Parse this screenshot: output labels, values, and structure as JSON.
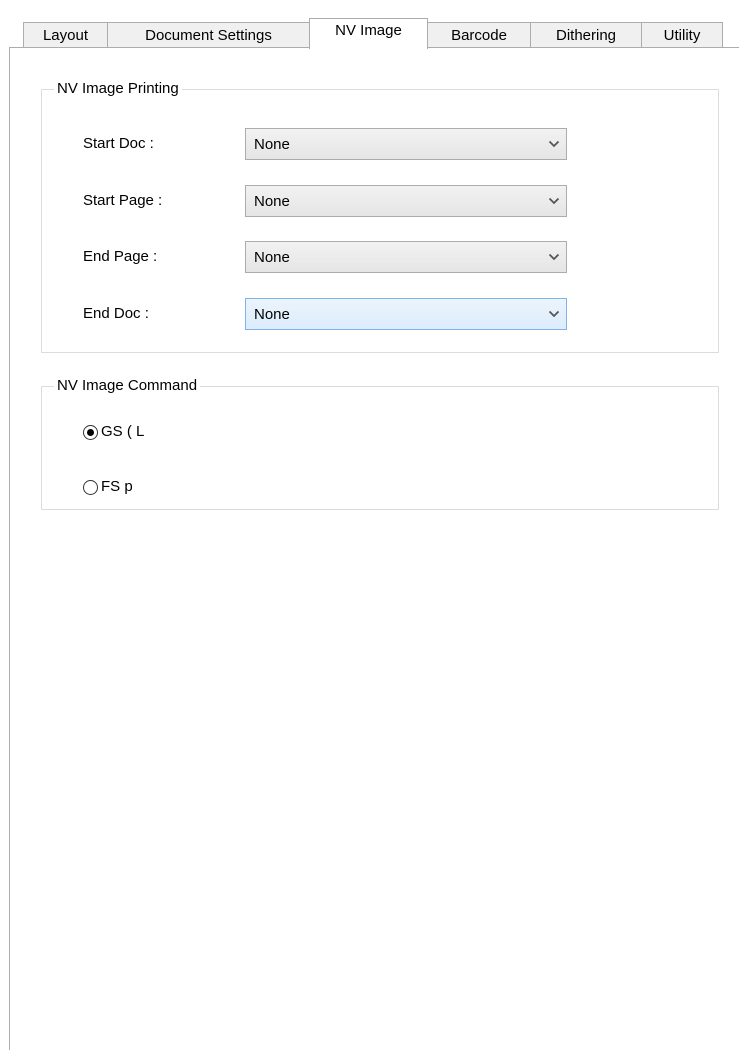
{
  "tabs": [
    {
      "label": "Layout",
      "active": false
    },
    {
      "label": "Document Settings",
      "active": false
    },
    {
      "label": "NV Image",
      "active": true
    },
    {
      "label": "Barcode",
      "active": false
    },
    {
      "label": "Dithering",
      "active": false
    },
    {
      "label": "Utility",
      "active": false
    }
  ],
  "printing_group": {
    "title": "NV Image Printing",
    "rows": [
      {
        "label": "Start Doc :",
        "value": "None"
      },
      {
        "label": "Start Page :",
        "value": "None"
      },
      {
        "label": "End Page :",
        "value": "None"
      },
      {
        "label": "End Doc :",
        "value": "None"
      }
    ]
  },
  "command_group": {
    "title": "NV Image Command",
    "options": [
      {
        "label": "GS ( L",
        "selected": true
      },
      {
        "label": "FS p",
        "selected": false
      }
    ]
  },
  "colors": {
    "tab_border": "#adadad",
    "group_border": "#dcdcdc",
    "combo_focus_border": "#7eb4ea"
  },
  "icons": {
    "dropdown": "chevron-down-icon",
    "radio_selected": "radio-selected-icon",
    "radio_unselected": "radio-unselected-icon"
  }
}
